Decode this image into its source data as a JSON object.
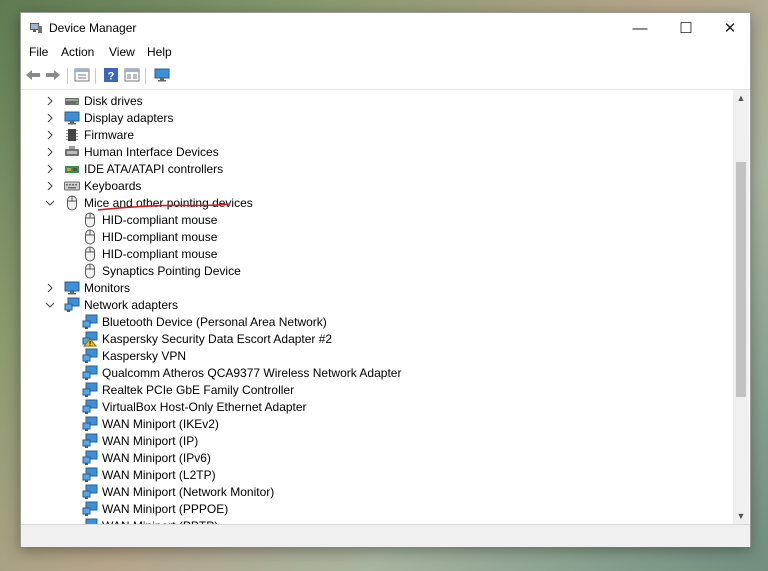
{
  "window": {
    "title": "Device Manager",
    "minimize": "—",
    "maximize": "☐",
    "close": "✕"
  },
  "menu": [
    "File",
    "Action",
    "View",
    "Help"
  ],
  "toolbar": [
    "back-icon",
    "forward-icon",
    "properties-icon",
    "help-icon",
    "scan-icon",
    "monitor-icon"
  ],
  "tree": [
    {
      "label": "Disk drives",
      "level": 0,
      "expander": "collapsed",
      "icon": "disk-drive-icon"
    },
    {
      "label": "Display adapters",
      "level": 0,
      "expander": "collapsed",
      "icon": "display-adapter-icon"
    },
    {
      "label": "Firmware",
      "level": 0,
      "expander": "collapsed",
      "icon": "firmware-icon"
    },
    {
      "label": "Human Interface Devices",
      "level": 0,
      "expander": "collapsed",
      "icon": "hid-icon"
    },
    {
      "label": "IDE ATA/ATAPI controllers",
      "level": 0,
      "expander": "collapsed",
      "icon": "ide-controller-icon"
    },
    {
      "label": "Keyboards",
      "level": 0,
      "expander": "collapsed",
      "icon": "keyboard-icon"
    },
    {
      "label": "Mice and other pointing devices",
      "level": 0,
      "expander": "expanded",
      "icon": "mouse-icon"
    },
    {
      "label": "HID-compliant mouse",
      "level": 1,
      "expander": "none",
      "icon": "mouse-icon"
    },
    {
      "label": "HID-compliant mouse",
      "level": 1,
      "expander": "none",
      "icon": "mouse-icon"
    },
    {
      "label": "HID-compliant mouse",
      "level": 1,
      "expander": "none",
      "icon": "mouse-icon"
    },
    {
      "label": "Synaptics Pointing Device",
      "level": 1,
      "expander": "none",
      "icon": "mouse-icon"
    },
    {
      "label": "Monitors",
      "level": 0,
      "expander": "collapsed",
      "icon": "monitor-icon"
    },
    {
      "label": "Network adapters",
      "level": 0,
      "expander": "expanded",
      "icon": "network-adapter-icon"
    },
    {
      "label": "Bluetooth Device (Personal Area Network)",
      "level": 1,
      "expander": "none",
      "icon": "network-adapter-icon"
    },
    {
      "label": "Kaspersky Security Data Escort Adapter #2",
      "level": 1,
      "expander": "none",
      "icon": "network-adapter-warning-icon"
    },
    {
      "label": "Kaspersky VPN",
      "level": 1,
      "expander": "none",
      "icon": "network-adapter-icon"
    },
    {
      "label": "Qualcomm Atheros QCA9377 Wireless Network Adapter",
      "level": 1,
      "expander": "none",
      "icon": "network-adapter-icon"
    },
    {
      "label": "Realtek PCIe GbE Family Controller",
      "level": 1,
      "expander": "none",
      "icon": "network-adapter-icon"
    },
    {
      "label": "VirtualBox Host-Only Ethernet Adapter",
      "level": 1,
      "expander": "none",
      "icon": "network-adapter-icon"
    },
    {
      "label": "WAN Miniport (IKEv2)",
      "level": 1,
      "expander": "none",
      "icon": "network-adapter-icon"
    },
    {
      "label": "WAN Miniport (IP)",
      "level": 1,
      "expander": "none",
      "icon": "network-adapter-icon"
    },
    {
      "label": "WAN Miniport (IPv6)",
      "level": 1,
      "expander": "none",
      "icon": "network-adapter-icon"
    },
    {
      "label": "WAN Miniport (L2TP)",
      "level": 1,
      "expander": "none",
      "icon": "network-adapter-icon"
    },
    {
      "label": "WAN Miniport (Network Monitor)",
      "level": 1,
      "expander": "none",
      "icon": "network-adapter-icon"
    },
    {
      "label": "WAN Miniport (PPPOE)",
      "level": 1,
      "expander": "none",
      "icon": "network-adapter-icon"
    },
    {
      "label": "WAN Miniport (PPTP)",
      "level": 1,
      "expander": "none",
      "icon": "network-adapter-icon"
    }
  ],
  "annotation": {
    "underline_color": "#d0202a"
  }
}
